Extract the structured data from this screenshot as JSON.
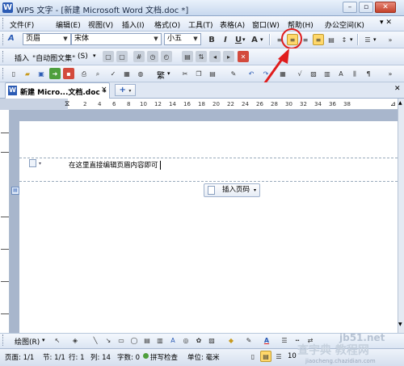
{
  "window": {
    "title": "WPS 文字 - [新建 Microsoft Word 文档.doc *]",
    "logo": "W",
    "minimize": "–",
    "restore": "▫",
    "close": "✕"
  },
  "menubar": {
    "items": [
      "文件(F)",
      "编辑(E)",
      "视图(V)",
      "插入(I)",
      "格式(O)",
      "工具(T)",
      "表格(A)",
      "窗口(W)",
      "帮助(H)",
      "办公空间(K)"
    ]
  },
  "format_toolbar": {
    "style_value": "页眉",
    "font_value": "宋体",
    "size_value": "小五",
    "bold": "B",
    "italic": "I",
    "underline": "U",
    "font_color": "A"
  },
  "insert_toolbar": {
    "insert_label": "插入",
    "autotext_label": "\"自动图文集\"",
    "indicator": "(S)"
  },
  "standard_toolbar": {
    "traditional": "繁"
  },
  "tabs": {
    "doc_tab": "新建 Micro...文档.doc *",
    "close": "×",
    "new": "+"
  },
  "ruler": {
    "numbers": [
      "2",
      "4",
      "6",
      "8",
      "10",
      "12",
      "14",
      "16",
      "18",
      "20",
      "22",
      "24",
      "26",
      "28",
      "30",
      "32",
      "34",
      "36",
      "38"
    ]
  },
  "document": {
    "header_text": "在这里直接编辑页眉内容即可",
    "insert_page_number": "插入页码"
  },
  "draw_toolbar": {
    "draw_label": "绘图(R)"
  },
  "statusbar": {
    "page": "页面: 1/1",
    "section": "节: 1/1",
    "line": "行: 1",
    "column": "列: 14",
    "chars": "字数: 0",
    "spellcheck": "拼写检查",
    "unit": "单位: 毫米",
    "zoom": "10"
  },
  "watermark": {
    "site": "jb51.net",
    "title": "查字典 教程网",
    "url": "jiaocheng.chazidian.com"
  },
  "colors": {
    "annotation": "#e01d1d",
    "active_align": "#ffd86b"
  }
}
